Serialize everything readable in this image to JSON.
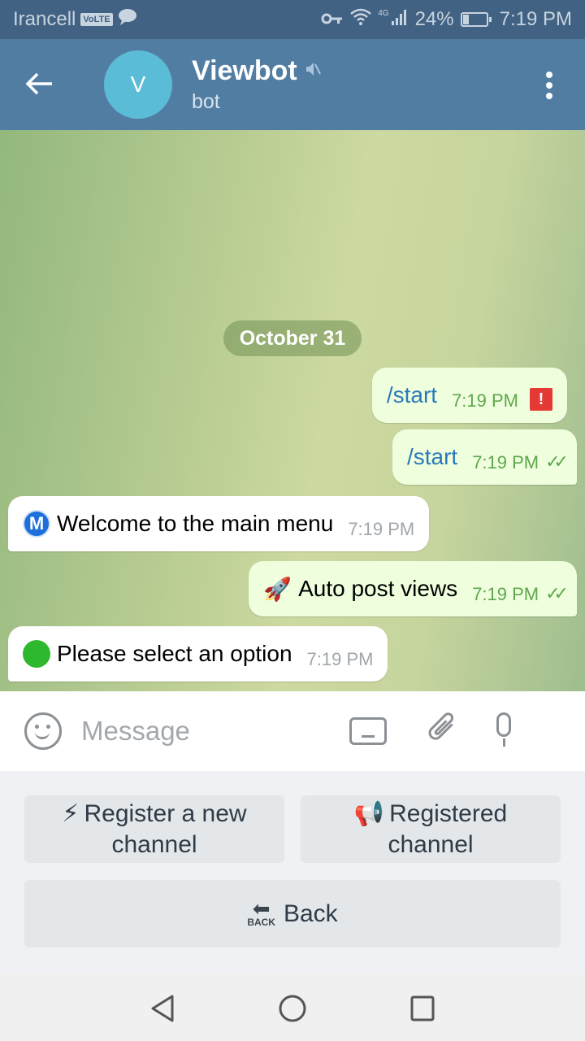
{
  "status_bar": {
    "carrier": "Irancell",
    "volte": "VoLTE",
    "network": "4G",
    "battery": "24%",
    "battery_level": 0.24,
    "time": "7:19 PM"
  },
  "header": {
    "avatar_letter": "V",
    "title": "Viewbot",
    "subtitle": "bot"
  },
  "chat": {
    "date_label": "October 31",
    "messages": [
      {
        "direction": "out",
        "text": "/start",
        "time": "7:19 PM",
        "status": "error",
        "status_glyph": "!"
      },
      {
        "direction": "out",
        "text": "/start",
        "time": "7:19 PM",
        "status": "read",
        "status_glyph": "✓✓"
      },
      {
        "direction": "in",
        "emoji": "M",
        "text": "Welcome to the main menu",
        "time": "7:19 PM"
      },
      {
        "direction": "out",
        "emoji": "🚀",
        "text": "Auto post views",
        "time": "7:19 PM",
        "status": "read",
        "status_glyph": "✓✓"
      },
      {
        "direction": "in",
        "emoji": "green-circle",
        "text": "Please select an option",
        "time": "7:19 PM"
      }
    ]
  },
  "input": {
    "placeholder": "Message",
    "value": ""
  },
  "keyboard": {
    "buttons": [
      {
        "emoji": "⚡",
        "label": "Register a new channel"
      },
      {
        "emoji": "📢",
        "label": "Registered channel"
      },
      {
        "emoji": "⬅",
        "emoji_caption": "BACK",
        "label": "Back"
      }
    ]
  },
  "icons": {
    "back_arrow": "←",
    "mute": "🔇",
    "clip": "📎",
    "nav_back": "◁",
    "nav_home": "○",
    "nav_recent": "□"
  }
}
